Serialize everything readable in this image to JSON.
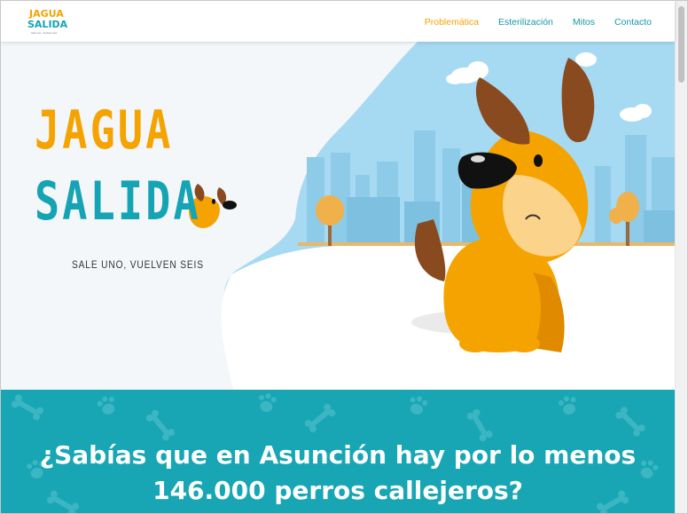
{
  "header": {
    "logo": {
      "line1": "JAGUA",
      "line2": "SALIDA",
      "line3": "sale uno, vuelven seis"
    },
    "nav": [
      {
        "label": "Problemática",
        "active": true
      },
      {
        "label": "Esterilización",
        "active": false
      },
      {
        "label": "Mitos",
        "active": false
      },
      {
        "label": "Contacto",
        "active": false
      }
    ]
  },
  "hero": {
    "title_line1": "JAGUA",
    "title_line2": "SALIDA",
    "tagline": "SALE UNO, VUELVEN SEIS"
  },
  "banner": {
    "line1": "¿Sabías que en Asunción hay por lo menos",
    "line2": "146.000 perros callejeros?"
  },
  "colors": {
    "accent_orange": "#f5a300",
    "accent_teal": "#14a4b4",
    "banner_bg": "#18a6b4",
    "sky": "#a6d9f2"
  }
}
